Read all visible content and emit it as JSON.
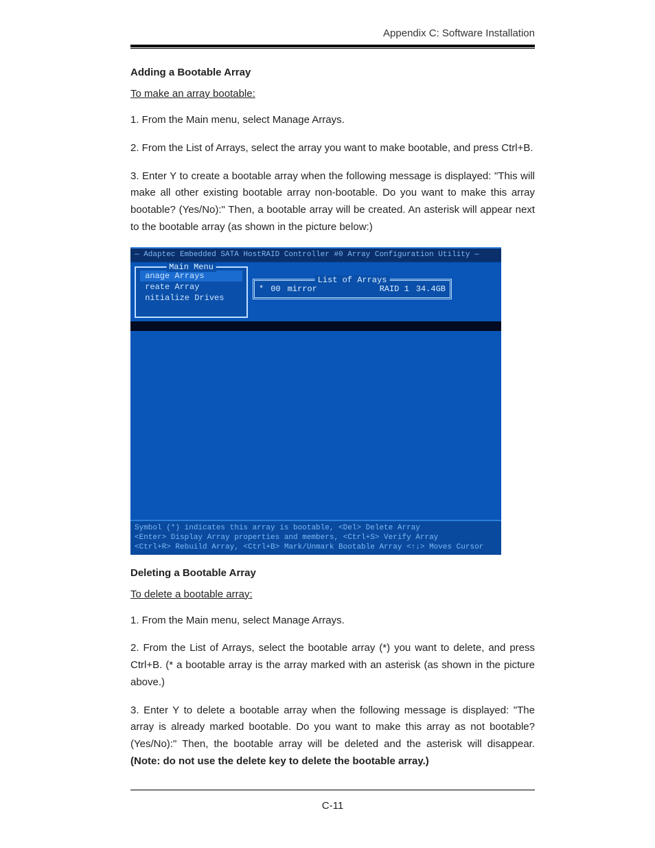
{
  "header": {
    "right_text": "Appendix C: Software Installation"
  },
  "sections": {
    "adding": {
      "heading": "Adding a Bootable Array",
      "intro": "To make an array bootable:",
      "step1": "1. From the Main menu, select Manage Arrays.",
      "step2": "2. From the List of Arrays, select the array you want to make bootable, and press Ctrl+B.",
      "step3": "3. Enter Y to create a bootable array when the following message is displayed: \"This will make all other existing bootable array non-bootable. Do you want to make this array bootable? (Yes/No):\"  Then, a bootable array will be created.  An asterisk will appear next to the bootable array (as shown in the picture below:)"
    },
    "deleting": {
      "heading": "Deleting a Bootable Array",
      "intro": "To delete a bootable array:",
      "step1": "1. From the Main menu, select Manage Arrays.",
      "step2": "2. From the List of Arrays, select the bootable array (*) you want to delete, and press Ctrl+B. (* a bootable array is the array marked with an asterisk  (as shown in the picture above.)",
      "step3_text": "3. Enter Y to delete a bootable array when the following message is displayed: \"The array is already marked bootable. Do you want to make this array as not bootable? (Yes/No):\" Then,  the bootable array will be deleted and the asterisk will disappear.",
      "step3_note": "(Note: do not use the delete key to delete the bootable array.)"
    }
  },
  "bios": {
    "titlebar": "— Adaptec Embedded SATA HostRAID Controller #0 Array Configuration Utility —",
    "main_menu": {
      "title": "Main Menu",
      "items": [
        {
          "label": " anage Arrays",
          "selected": true
        },
        {
          "label": " reate Array",
          "selected": false
        },
        {
          "label": " nitialize Drives",
          "selected": false
        }
      ]
    },
    "list_panel": {
      "title": "List of Arrays",
      "row": {
        "marker": "*",
        "id": "00",
        "name": "mirror",
        "raid": "RAID 1",
        "size": "34.4GB"
      }
    },
    "footer": {
      "line1": "Symbol (*) indicates this array is bootable, <Del> Delete Array",
      "line2": "<Enter> Display Array properties and members, <Ctrl+S> Verify Array",
      "line3": "<Ctrl+R> Rebuild Array, <Ctrl+B> Mark/Unmark Bootable Array <↑↓> Moves Cursor"
    }
  },
  "page_number": "C-11"
}
